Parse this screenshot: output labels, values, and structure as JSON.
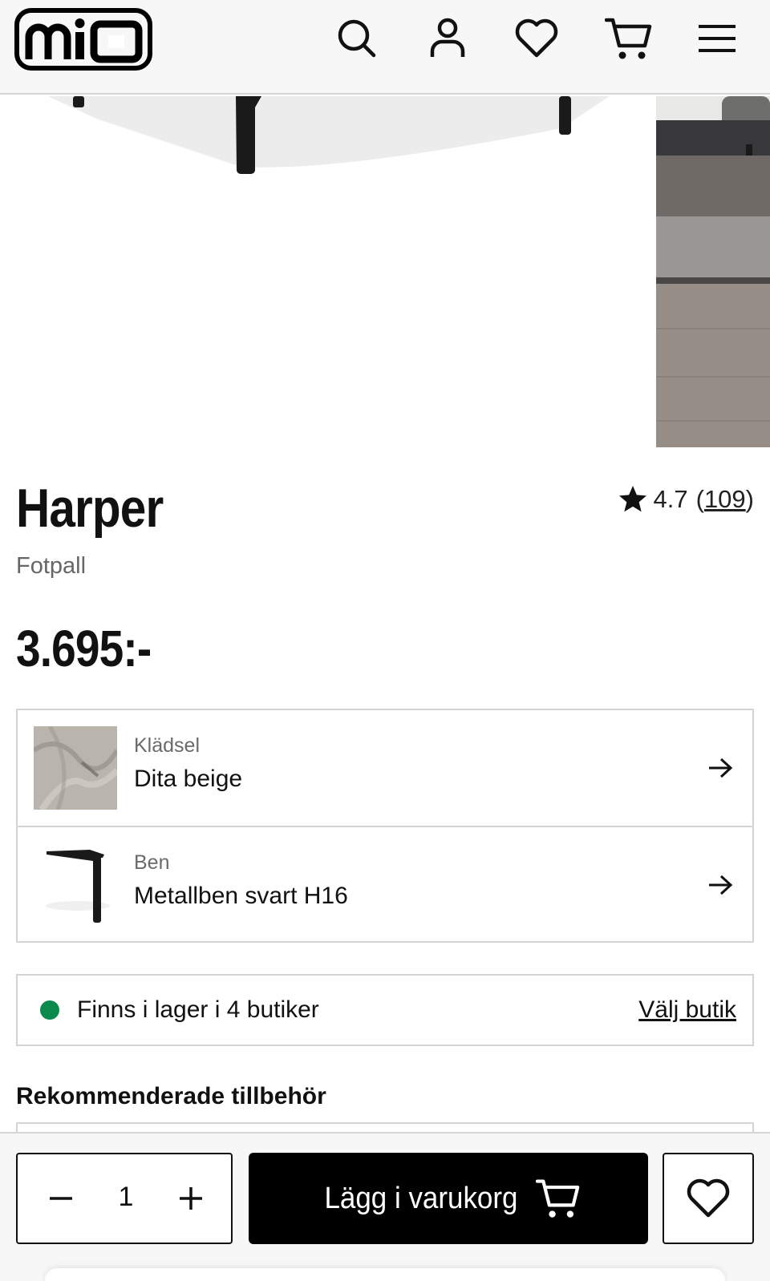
{
  "header": {
    "logo_text": "mio",
    "icons": [
      "search-icon",
      "account-icon",
      "wishlist-icon",
      "cart-icon",
      "menu-icon"
    ]
  },
  "product": {
    "name": "Harper",
    "category": "Fotpall",
    "price": "3.695:-",
    "rating": {
      "value": "4.7",
      "count_open": "(",
      "count": "109",
      "count_close": ")"
    }
  },
  "options": [
    {
      "label": "Klädsel",
      "value": "Dita beige"
    },
    {
      "label": "Ben",
      "value": "Metallben svart H16"
    }
  ],
  "stock": {
    "text": "Finns i lager i 4 butiker",
    "link": "Välj butik",
    "status_color": "#0b8a4c"
  },
  "recommended": {
    "heading": "Rekommenderade tillbehör"
  },
  "cart_bar": {
    "quantity": "1",
    "add_label": "Lägg i varukorg"
  }
}
